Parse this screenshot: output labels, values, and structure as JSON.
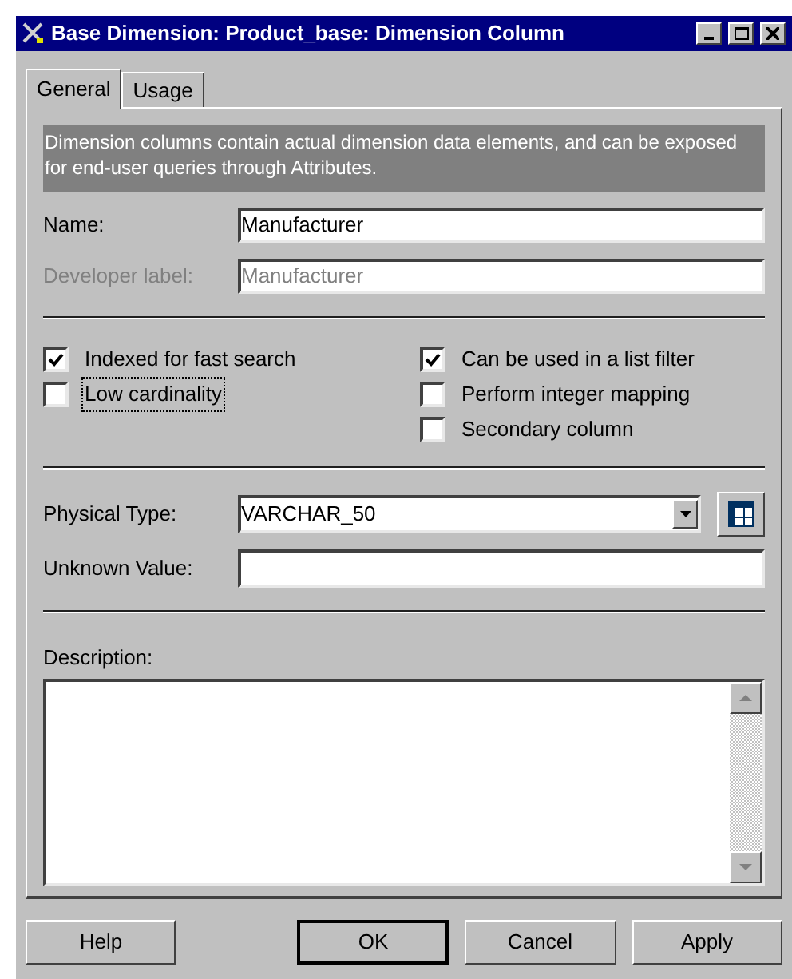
{
  "window": {
    "title": "Base Dimension: Product_base: Dimension Column"
  },
  "tabs": [
    {
      "label": "General",
      "selected": true
    },
    {
      "label": "Usage",
      "selected": false
    }
  ],
  "info": "Dimension columns contain actual dimension data elements, and can be exposed for end-user queries through Attributes.",
  "name_fields": [
    {
      "label": "Name:",
      "value": "Manufacturer",
      "disabled": false
    },
    {
      "label": "Developer label:",
      "value": "Manufacturer",
      "disabled": true
    }
  ],
  "options_left": [
    {
      "label": "Indexed for fast search",
      "checked": true,
      "focused": false
    },
    {
      "label": "Low cardinality",
      "checked": false,
      "focused": true
    }
  ],
  "options_right": [
    {
      "label": "Can be used in a list filter",
      "checked": true,
      "focused": false
    },
    {
      "label": "Perform integer mapping",
      "checked": false,
      "focused": false
    },
    {
      "label": "Secondary column",
      "checked": false,
      "focused": false
    }
  ],
  "physical_type": {
    "label": "Physical Type:",
    "value": "VARCHAR_50"
  },
  "unknown_value": {
    "label": "Unknown Value:"
  },
  "description": {
    "label": "Description:"
  },
  "buttons": [
    {
      "label": "Help",
      "default": false
    },
    {
      "label": "OK",
      "default": true
    },
    {
      "label": "Cancel",
      "default": false
    },
    {
      "label": "Apply",
      "default": false
    }
  ]
}
